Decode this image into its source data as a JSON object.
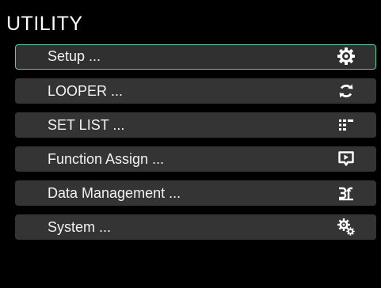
{
  "screen": {
    "title": "UTILITY"
  },
  "menu": {
    "items": [
      {
        "label": "Setup ...",
        "icon": "gear-icon",
        "selected": true
      },
      {
        "label": "LOOPER ...",
        "icon": "loop-arrows-icon",
        "selected": false
      },
      {
        "label": "SET LIST ...",
        "icon": "set-list-icon",
        "selected": false
      },
      {
        "label": "Function Assign ...",
        "icon": "function-assign-icon",
        "selected": false
      },
      {
        "label": "Data Management ...",
        "icon": "data-management-icon",
        "selected": false
      },
      {
        "label": "System ...",
        "icon": "system-gears-icon",
        "selected": false
      }
    ]
  },
  "colors": {
    "background": "#000000",
    "item_background": "#343434",
    "selection_border": "#4fd0a0",
    "text": "#ffffff"
  }
}
